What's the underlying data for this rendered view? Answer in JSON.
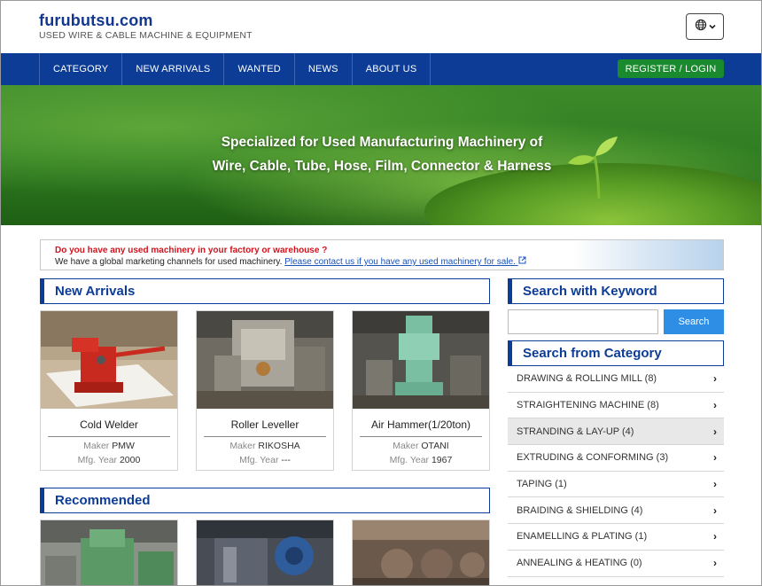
{
  "header": {
    "title": "furubutsu.com",
    "subtitle": "USED WIRE & CABLE MACHINE & EQUIPMENT",
    "lang_icon": "globe-icon",
    "lang_chevron": "chevron-down-icon"
  },
  "nav": {
    "items": [
      {
        "label": "CATEGORY"
      },
      {
        "label": "NEW ARRIVALS"
      },
      {
        "label": "WANTED"
      },
      {
        "label": "NEWS"
      },
      {
        "label": "ABOUT US"
      }
    ],
    "register_label": "REGISTER / LOGIN"
  },
  "hero": {
    "line1": "Specialized for Used Manufacturing Machinery of",
    "line2": "Wire, Cable, Tube, Hose, Film, Connector & Harness"
  },
  "notice": {
    "question": "Do you have any used machinery in your factory or warehouse ?",
    "text": "We have a global marketing channels for used machinery.",
    "link": "Please contact us if you have any used machinery for sale."
  },
  "new_arrivals": {
    "heading": "New Arrivals",
    "maker_label": "Maker",
    "year_label": "Mfg. Year",
    "items": [
      {
        "title": "Cold Welder",
        "maker": "PMW",
        "year": "2000"
      },
      {
        "title": "Roller Leveller",
        "maker": "RIKOSHA",
        "year": "---"
      },
      {
        "title": "Air Hammer(1/20ton)",
        "maker": "OTANI",
        "year": "1967"
      }
    ]
  },
  "recommended": {
    "heading": "Recommended"
  },
  "search": {
    "heading": "Search with Keyword",
    "placeholder": "",
    "button": "Search"
  },
  "category": {
    "heading": "Search from Category",
    "items": [
      {
        "label": "DRAWING & ROLLING MILL (8)"
      },
      {
        "label": "STRAIGHTENING MACHINE (8)"
      },
      {
        "label": "STRANDING & LAY-UP (4)"
      },
      {
        "label": "EXTRUDING & CONFORMING (3)"
      },
      {
        "label": "TAPING (1)"
      },
      {
        "label": "BRAIDING & SHIELDING (4)"
      },
      {
        "label": "ENAMELLING & PLATING (1)"
      },
      {
        "label": "ANNEALING & HEATING (0)"
      }
    ]
  },
  "colors": {
    "brand_blue": "#0d3c97",
    "register_green": "#1a8a2e",
    "search_blue": "#2e8ee6",
    "notice_red": "#d0131d"
  }
}
